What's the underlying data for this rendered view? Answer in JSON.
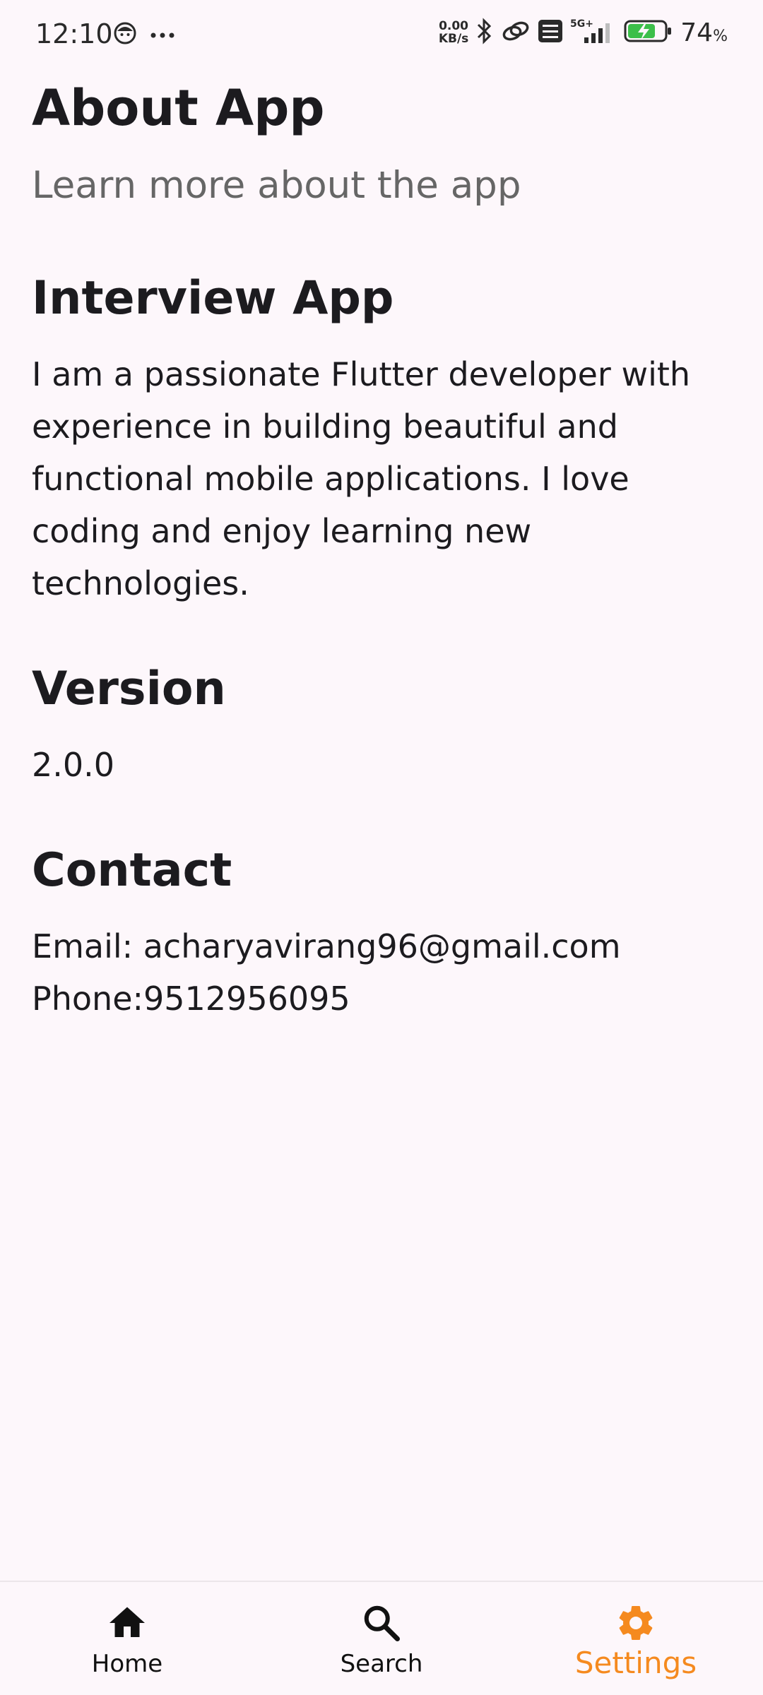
{
  "status_bar": {
    "time": "12:10",
    "net_speed_value": "0.00",
    "net_speed_unit": "KB/s",
    "signal_label": "5G+",
    "battery_percent": "74",
    "battery_unit": "%"
  },
  "page": {
    "title": "About App",
    "subtitle": "Learn more about the app"
  },
  "sections": {
    "app": {
      "heading": "Interview App",
      "body": "I am a passionate Flutter developer with experience in building beautiful and functional mobile applications. I love coding and enjoy learning new technologies."
    },
    "version": {
      "heading": "Version",
      "body": "2.0.0"
    },
    "contact": {
      "heading": "Contact",
      "email": "Email: acharyavirang96@gmail.com",
      "phone": "Phone:9512956095"
    }
  },
  "bottom_nav": {
    "items": [
      {
        "label": "Home",
        "icon": "home-icon",
        "active": false
      },
      {
        "label": "Search",
        "icon": "search-icon",
        "active": false
      },
      {
        "label": "Settings",
        "icon": "gear-icon",
        "active": true
      }
    ],
    "active_color": "#f58a1f",
    "inactive_color": "#111111"
  }
}
